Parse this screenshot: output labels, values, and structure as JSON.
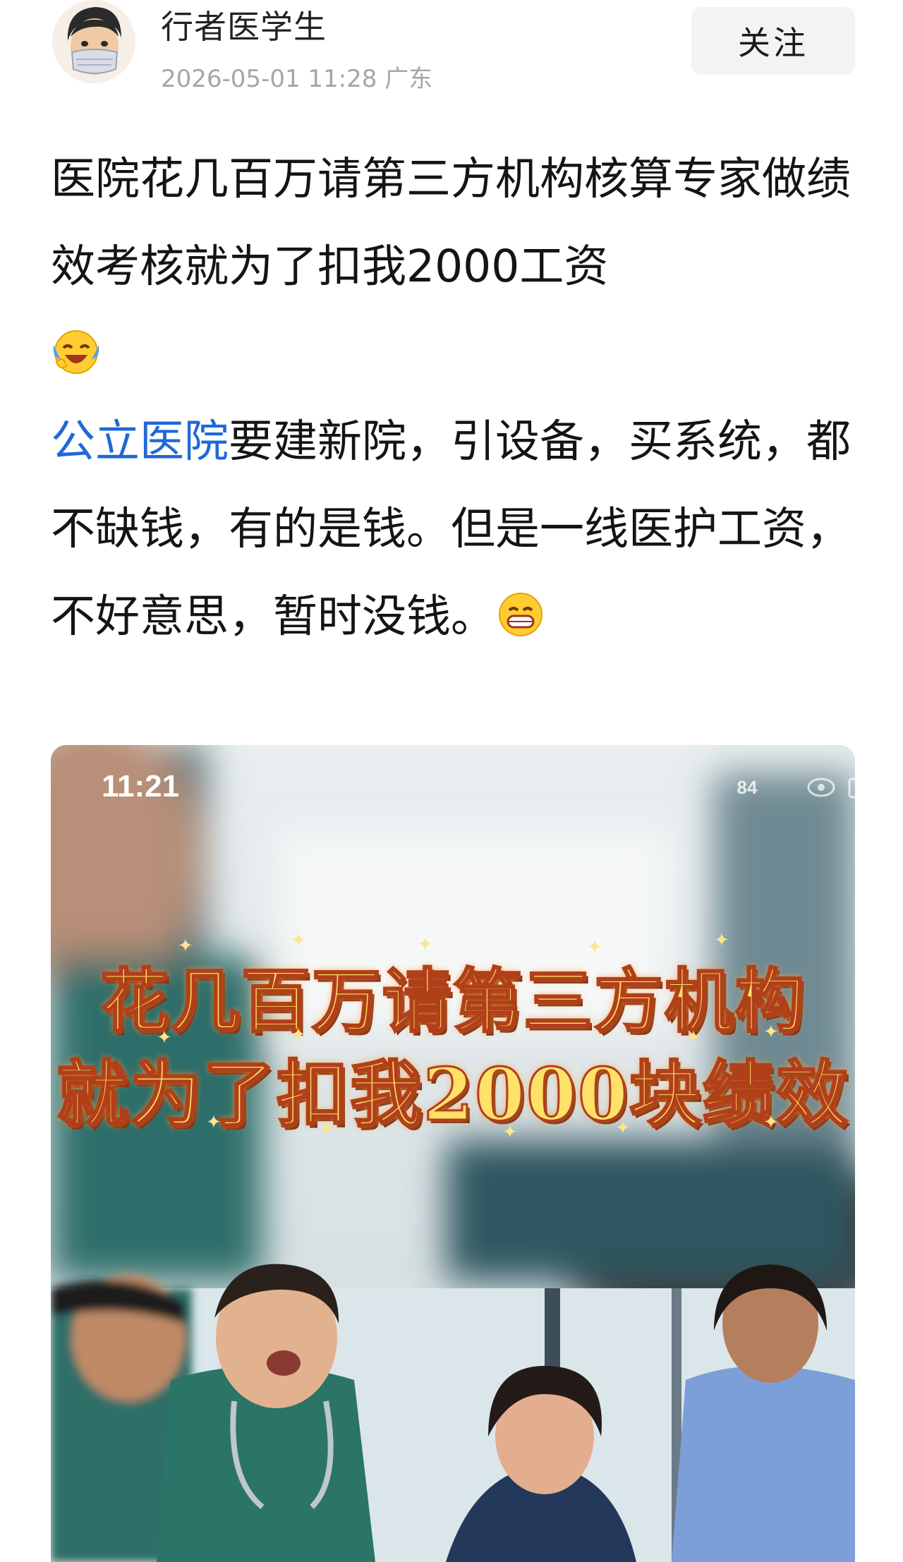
{
  "header": {
    "author_name": "行者医学生",
    "meta": "2026-05-01 11:28 广东",
    "follow_label": "关注"
  },
  "post": {
    "line1": "医院花几百万请第三方机构核算专家做绩效考核就为了扣我2000工资",
    "line2_link": "公立医院",
    "line2_rest": "要建新院，引设备，买系统，都不缺钱，有的是钱。但是一线医护工资，不好意思，暂时没钱。",
    "emoji1": "crying-laughing-emoji",
    "emoji2": "grinning-emoji",
    "link_color": "#1f68d6"
  },
  "media": {
    "clock": "11:21",
    "battery": "84",
    "headline_line1": "花几百万请第三方机构",
    "headline_line2": "就为了扣我2000块绩效"
  }
}
